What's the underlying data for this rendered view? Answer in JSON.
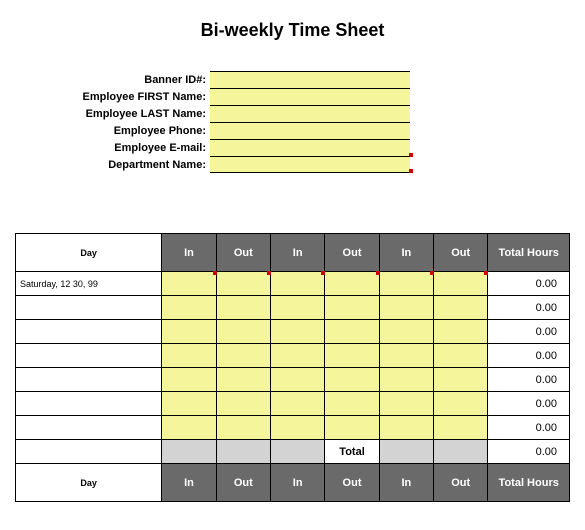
{
  "title": "Bi-weekly Time Sheet",
  "info": {
    "banner_id_label": "Banner ID#:",
    "first_name_label": "Employee FIRST Name:",
    "last_name_label": "Employee LAST Name:",
    "phone_label": "Employee Phone:",
    "email_label": "Employee E-mail:",
    "department_label": "Department Name:"
  },
  "headers": {
    "day": "Day",
    "in": "In",
    "out": "Out",
    "total_hours": "Total Hours",
    "total": "Total"
  },
  "rows": [
    {
      "day": "Saturday, 12 30, 99",
      "total": "0.00"
    },
    {
      "day": "",
      "total": "0.00"
    },
    {
      "day": "",
      "total": "0.00"
    },
    {
      "day": "",
      "total": "0.00"
    },
    {
      "day": "",
      "total": "0.00"
    },
    {
      "day": "",
      "total": "0.00"
    },
    {
      "day": "",
      "total": "0.00"
    }
  ],
  "grand_total": "0.00"
}
